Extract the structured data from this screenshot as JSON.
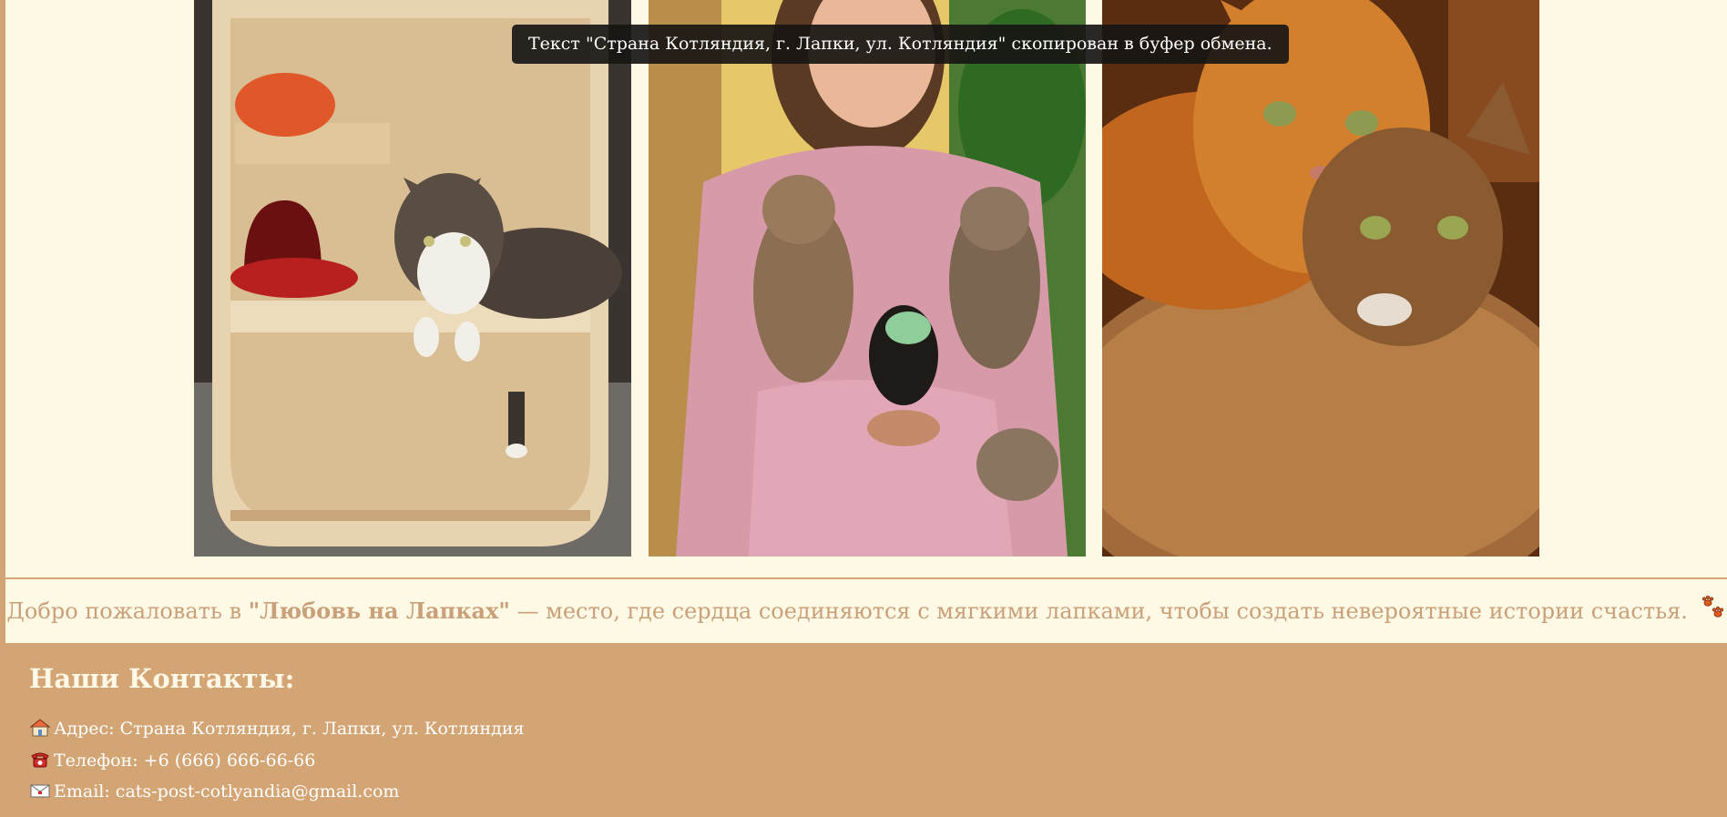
{
  "toast": {
    "message": "Текст \"Страна Котляндия, г. Лапки, ул. Котляндия\" скопирован в буфер обмена."
  },
  "gallery": {
    "photos": [
      {
        "name": "cat-on-shelf-photo"
      },
      {
        "name": "woman-with-kittens-photo"
      },
      {
        "name": "two-cats-on-bed-photo"
      }
    ]
  },
  "welcome": {
    "prefix": "Добро пожаловать в ",
    "brand": "\"Любовь на Лапках\"",
    "suffix": " — место, где сердца соединяются с мягкими лапками, чтобы создать невероятные истории счастья.",
    "icon": "paw-prints-icon"
  },
  "contacts": {
    "title": "Наши Контакты:",
    "address": {
      "icon": "house-icon",
      "text": "Адрес: Страна Котляндия, г. Лапки, ул. Котляндия"
    },
    "phone": {
      "icon": "telephone-icon",
      "text": "Телефон: +6 (666) 666-66-66"
    },
    "email": {
      "icon": "envelope-icon",
      "text": "Email: cats-post-cotlyandia@gmail.com"
    }
  },
  "colors": {
    "background": "#d4a574",
    "cream": "#fef9e4",
    "welcome_text": "#c9a07a",
    "toast_bg": "#181614"
  }
}
